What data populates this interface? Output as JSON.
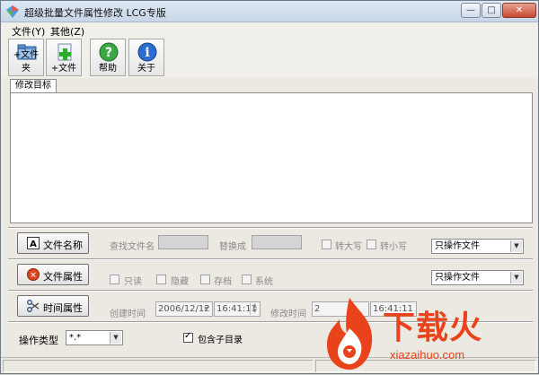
{
  "window": {
    "title": "超级批量文件属性修改 LCG专版",
    "controls": {
      "minimize": "—",
      "maximize": "□",
      "close": "✕"
    }
  },
  "menu": [
    {
      "label": "文件(Y)"
    },
    {
      "label": "其他(Z)"
    }
  ],
  "toolbar": [
    {
      "label": "+文件夹",
      "icon": "folder-add-icon"
    },
    {
      "label": "+文件",
      "icon": "file-add-icon"
    },
    {
      "label": "帮助",
      "icon": "help-icon"
    },
    {
      "label": "关于",
      "icon": "info-icon"
    }
  ],
  "tab": {
    "label": "修改目标"
  },
  "rename_row": {
    "button": "文件名称",
    "find_label": "查找文件名",
    "replace_label": "替换成",
    "upper_label": "转大写",
    "lower_label": "转小写",
    "scope": "只操作文件"
  },
  "attr_row": {
    "button": "文件属性",
    "readonly_label": "只读",
    "hidden_label": "隐藏",
    "archive_label": "存档",
    "system_label": "系统",
    "scope": "只操作文件"
  },
  "time_row": {
    "button": "时间属性",
    "created_label": "创建时间",
    "created_date": "2006/12/12",
    "created_time": "16:41:11",
    "modified_label": "修改时间",
    "modified_date": "2",
    "modified_time": "16:41:11"
  },
  "op_row": {
    "label": "操作类型",
    "pattern": "*.*",
    "include_sub_label": "包含子目录",
    "include_sub_checked": true
  },
  "watermark": {
    "brand": "下载火",
    "url": "xiazaihuo.com"
  },
  "colors": {
    "accent": "#e8431a",
    "help_green": "#3aa843",
    "info_blue": "#2c6fd0"
  }
}
